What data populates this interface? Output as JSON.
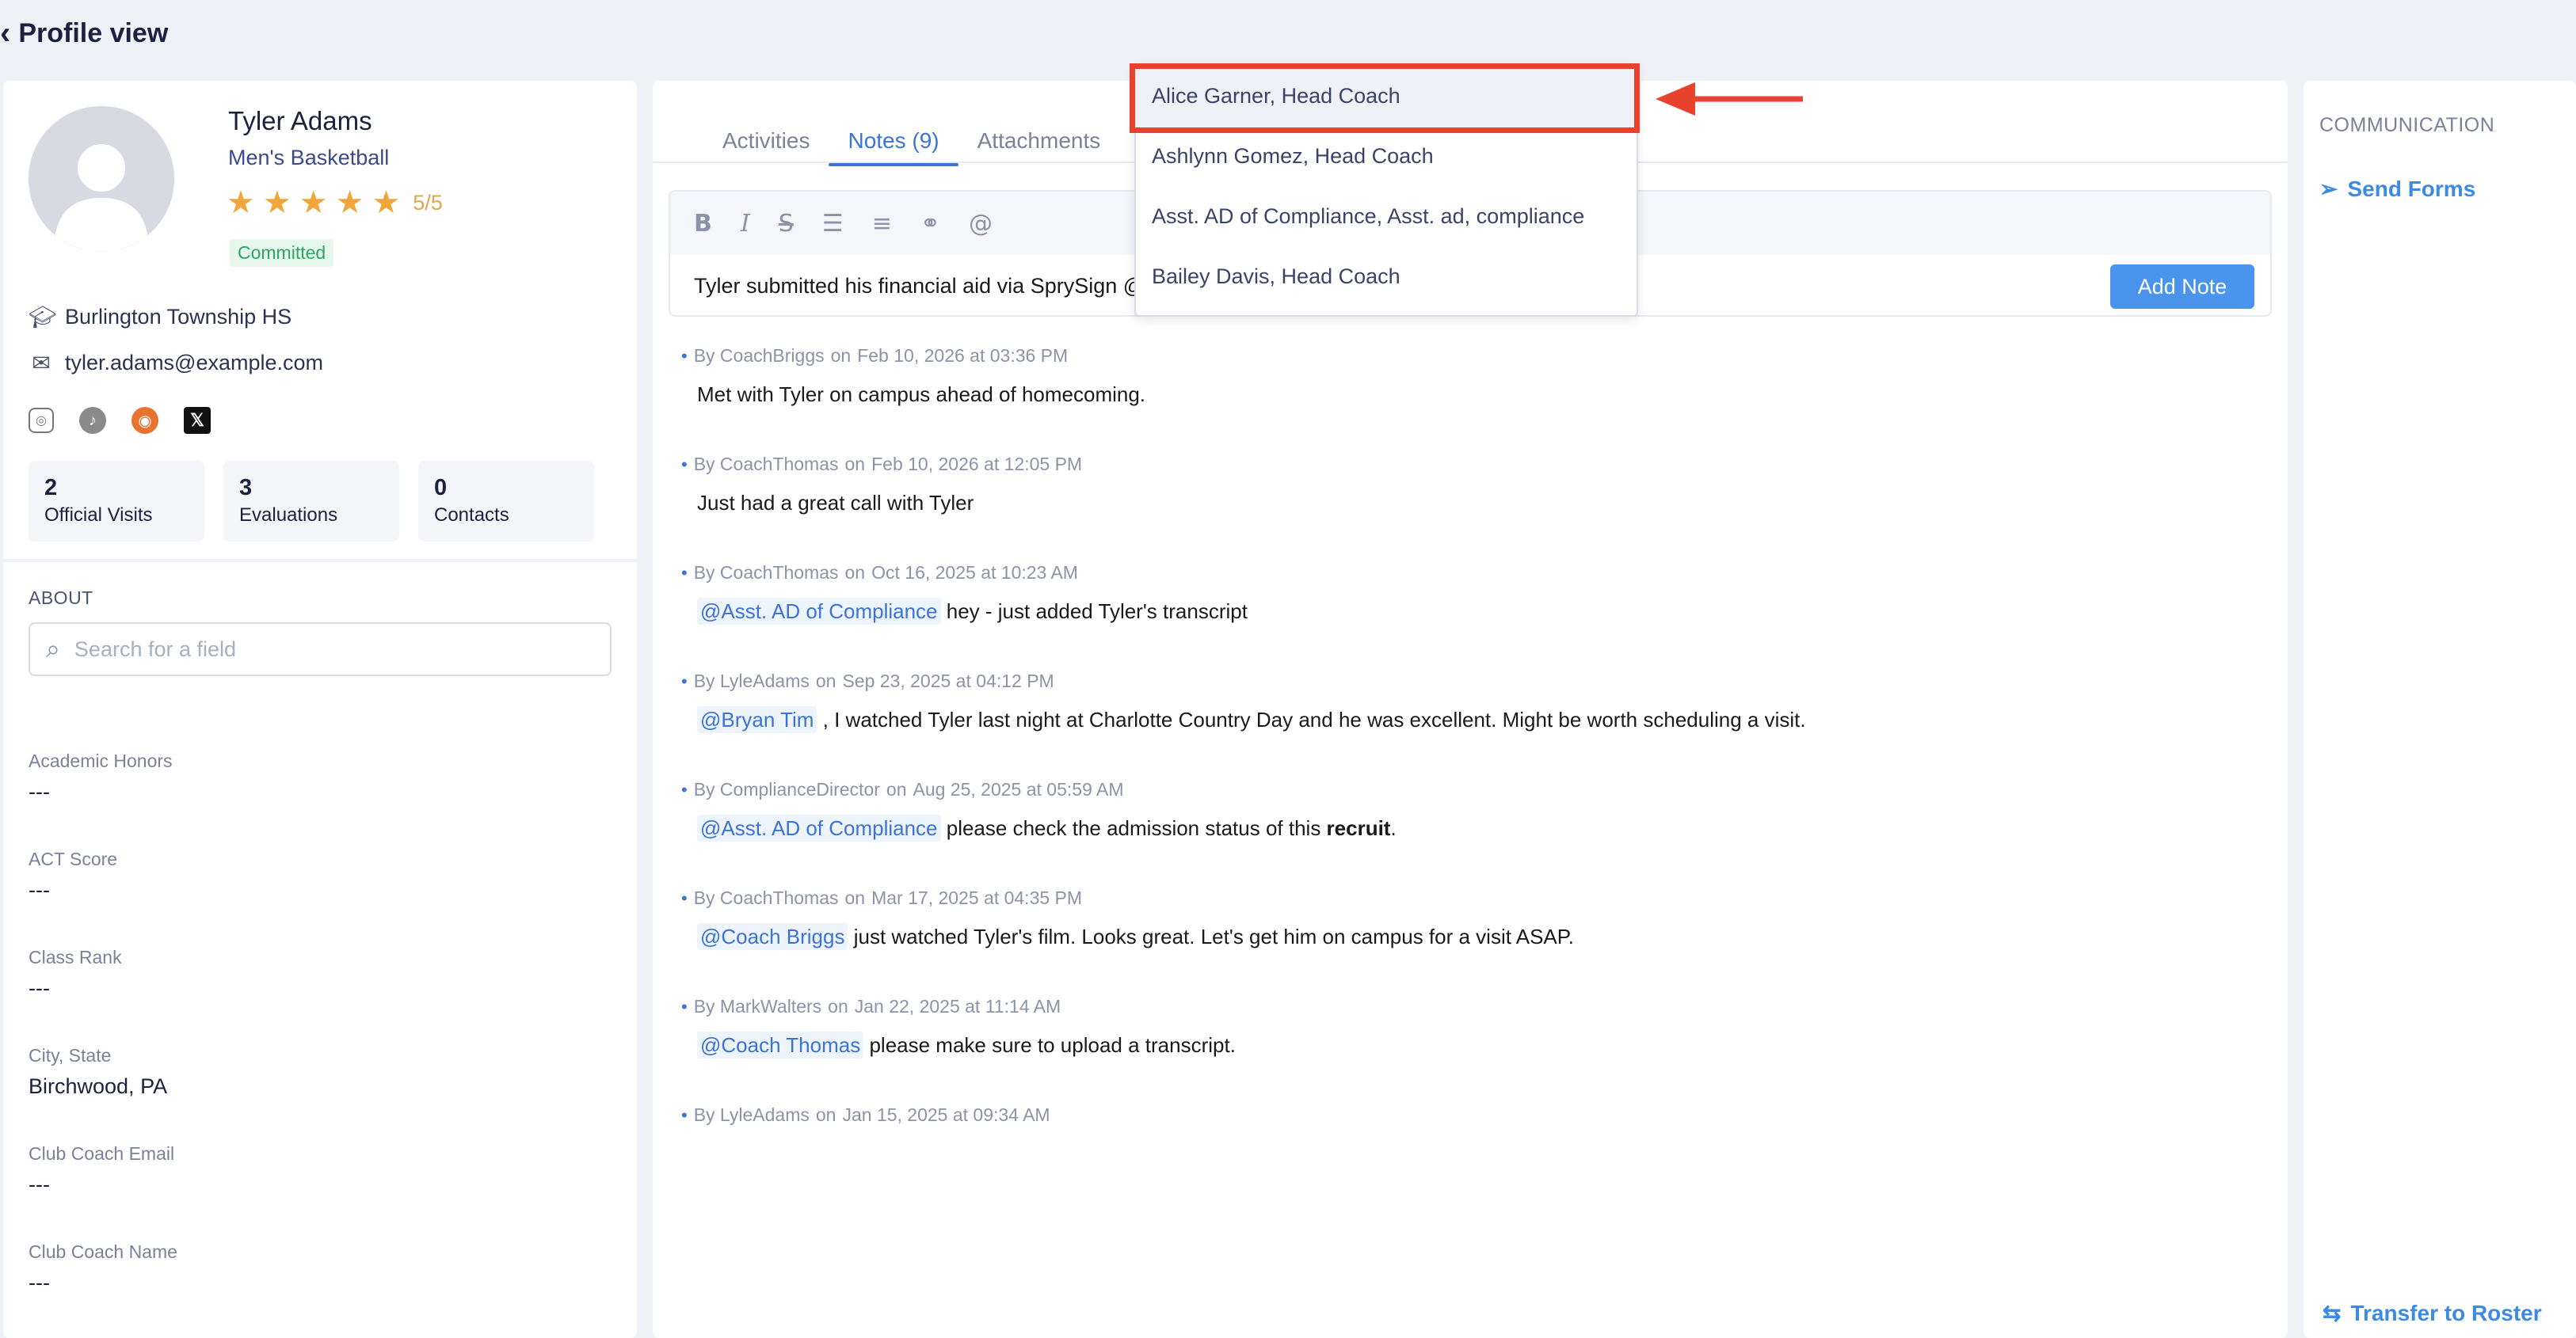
{
  "header": {
    "back_icon": "chevron-left-icon",
    "title": "Profile view"
  },
  "profile": {
    "name": "Tyler Adams",
    "sport": "Men's Basketball",
    "rating": {
      "stars": 5,
      "max": 5,
      "text": "5/5"
    },
    "status": "Committed",
    "school": "Burlington Township HS",
    "email": "tyler.adams@example.com",
    "socials": [
      "instagram-icon",
      "tiktok-icon",
      "hudl-icon",
      "x-icon"
    ],
    "stats": [
      {
        "value": "2",
        "label": "Official Visits"
      },
      {
        "value": "3",
        "label": "Evaluations"
      },
      {
        "value": "0",
        "label": "Contacts"
      }
    ]
  },
  "about": {
    "label": "ABOUT",
    "search_placeholder": "Search for a field",
    "fields": [
      {
        "label": "Academic Honors",
        "value": "---"
      },
      {
        "label": "ACT Score",
        "value": "---"
      },
      {
        "label": "Class Rank",
        "value": "---"
      },
      {
        "label": "City, State",
        "value": "Birchwood, PA"
      },
      {
        "label": "Club Coach Email",
        "value": "---"
      },
      {
        "label": "Club Coach Name",
        "value": "---"
      }
    ]
  },
  "tabs": [
    {
      "label": "Activities",
      "active": false
    },
    {
      "label": "Notes (9)",
      "active": true
    },
    {
      "label": "Attachments",
      "active": false
    }
  ],
  "editor": {
    "text": "Tyler submitted his financial aid via SprySign @",
    "add_note_label": "Add Note"
  },
  "mention_dropdown": {
    "options": [
      "Alice Garner, Head Coach",
      "Ashlynn Gomez, Head Coach",
      "Asst. AD of Compliance, Asst. ad, compliance",
      "Bailey Davis, Head Coach"
    ],
    "highlighted_index": 0
  },
  "notes": [
    {
      "author": "By CoachBriggs",
      "date": "Feb 10, 2026 at 03:36 PM",
      "mention": "",
      "text": "Met with Tyler on campus ahead of homecoming.",
      "bold": "",
      "tail": ""
    },
    {
      "author": "By CoachThomas",
      "date": "Feb 10, 2026 at 12:05 PM",
      "mention": "",
      "text": "Just had a great call with Tyler",
      "bold": "",
      "tail": ""
    },
    {
      "author": "By CoachThomas",
      "date": "Oct 16, 2025 at 10:23 AM",
      "mention": "@Asst. AD of Compliance",
      "text": " hey - just added Tyler's transcript",
      "bold": "",
      "tail": ""
    },
    {
      "author": "By LyleAdams",
      "date": "Sep 23, 2025 at 04:12 PM",
      "mention": "@Bryan Tim",
      "text": " , I watched Tyler last night at Charlotte Country Day and he was excellent. Might be worth scheduling a visit.",
      "bold": "",
      "tail": ""
    },
    {
      "author": "By ComplianceDirector",
      "date": "Aug 25, 2025 at 05:59 AM",
      "mention": "@Asst. AD of Compliance",
      "text": " please check the admission status of this ",
      "bold": "recruit",
      "tail": "."
    },
    {
      "author": "By CoachThomas",
      "date": "Mar 17, 2025 at 04:35 PM",
      "mention": "@Coach Briggs",
      "text": " just watched Tyler's film. Looks great. Let's get him on campus for a visit ASAP.",
      "bold": "",
      "tail": ""
    },
    {
      "author": "By MarkWalters",
      "date": "Jan 22, 2025 at 11:14 AM",
      "mention": "@Coach Thomas",
      "text": " please make sure to upload a transcript.",
      "bold": "",
      "tail": ""
    },
    {
      "author": "By LyleAdams",
      "date": "Jan 15, 2025 at 09:34 AM",
      "mention": "",
      "text": "",
      "bold": "",
      "tail": ""
    }
  ],
  "communication": {
    "label": "COMMUNICATION",
    "send_forms": "Send Forms",
    "transfer": "Transfer to Roster"
  },
  "colors": {
    "accent": "#3b73d9",
    "callout": "#e8412e",
    "star": "#f0a63a",
    "committed": "#2fa562"
  }
}
